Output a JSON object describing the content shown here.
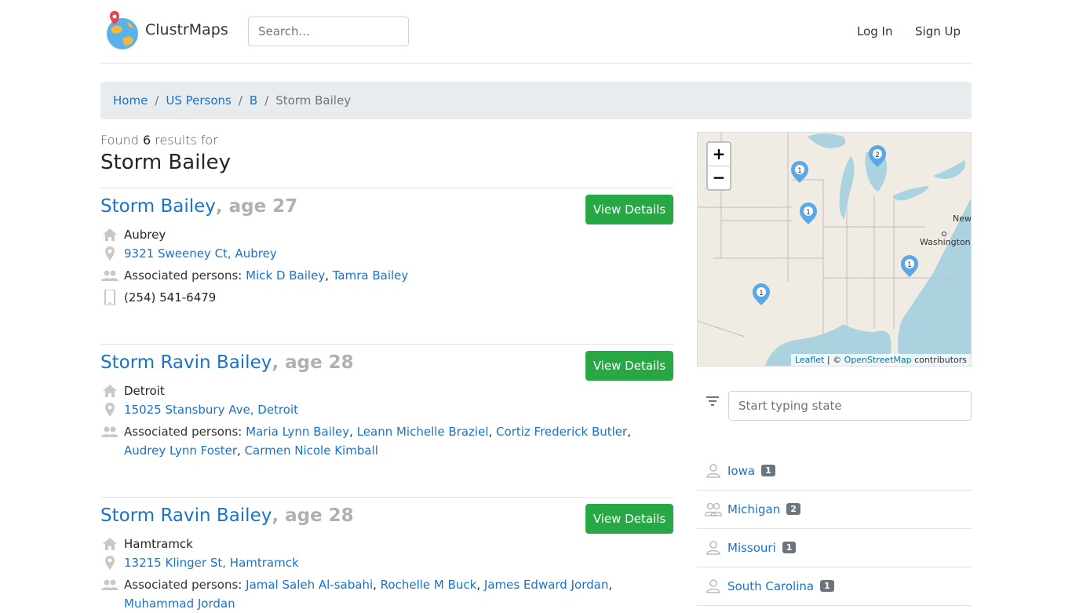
{
  "header": {
    "brand": "ClustrMaps",
    "search_placeholder": "Search...",
    "login": "Log In",
    "signup": "Sign Up"
  },
  "breadcrumb": {
    "home": "Home",
    "persons": "US Persons",
    "letter": "B",
    "current": "Storm Bailey",
    "separator": "/"
  },
  "summary": {
    "prefix": "Found",
    "count": "6",
    "suffix": "results for",
    "query": "Storm Bailey"
  },
  "view_details_label": "View Details",
  "results": [
    {
      "name": "Storm Bailey",
      "age": ", age 27",
      "city": "Aubrey",
      "address": "9321 Sweeney Ct, Aubrey",
      "associated_label": "Associated persons:",
      "associated_1": "Mick D Bailey",
      "associated_2": "Tamra Bailey",
      "phone": "(254) 541-6479"
    },
    {
      "name": "Storm Ravin Bailey",
      "age": ", age 28",
      "city": "Detroit",
      "address": "15025 Stansbury Ave, Detroit",
      "associated_label": "Associated persons:",
      "associated_1": "Maria Lynn Bailey",
      "associated_2": "Leann Michelle Braziel",
      "associated_3": "Cortiz Frederick Butler",
      "associated_4": "Audrey Lynn Foster",
      "associated_5": "Carmen Nicole Kimball"
    },
    {
      "name": "Storm Ravin Bailey",
      "age": ", age 28",
      "city": "Hamtramck",
      "address": "13215 Klinger St, Hamtramck",
      "associated_label": "Associated persons:",
      "associated_1": "Jamal Saleh Al-sabahi",
      "associated_2": "Rochelle M Buck",
      "associated_3": "James Edward Jordan",
      "associated_4": "Muhammad Jordan"
    }
  ],
  "map": {
    "zoom_in": "+",
    "zoom_out": "−",
    "attribution_leaflet": "Leaflet",
    "attribution_sep": " | © ",
    "attribution_osm": "OpenStreetMap",
    "attribution_suffix": " contributors",
    "label_washington": "Washington",
    "label_new": "New",
    "markers": [
      "1",
      "2",
      "1",
      "1",
      "1"
    ]
  },
  "state_filter": {
    "placeholder": "Start typing state",
    "states": [
      {
        "name": "Iowa",
        "count": "1"
      },
      {
        "name": "Michigan",
        "count": "2"
      },
      {
        "name": "Missouri",
        "count": "1"
      },
      {
        "name": "South Carolina",
        "count": "1"
      }
    ]
  },
  "colors": {
    "link": "#1a73c8",
    "button_green": "#28a745",
    "badge_gray": "#6c757d",
    "marker_blue": "#5aa9e6"
  }
}
